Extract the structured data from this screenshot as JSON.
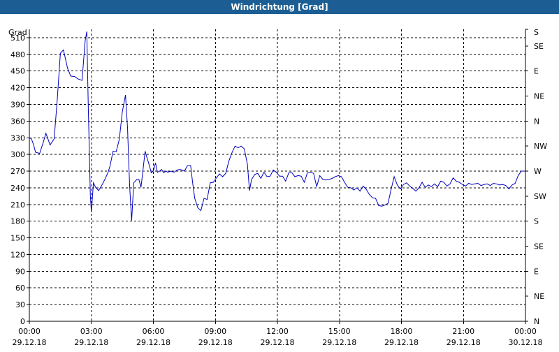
{
  "window": {
    "title": "Windrichtung [Grad]"
  },
  "colors": {
    "titlebar": "#1c5e93",
    "line": "#0000c0",
    "grid": "#000000"
  },
  "chart_data": {
    "type": "line",
    "title": "Windrichtung [Grad]",
    "ylabel": "Grad",
    "ylim": [
      0,
      525
    ],
    "grid": true,
    "y_ticks": [
      0,
      30,
      60,
      90,
      120,
      150,
      180,
      210,
      240,
      270,
      300,
      330,
      360,
      390,
      420,
      450,
      480,
      510
    ],
    "right_axis": {
      "ticks": [
        {
          "value": 0,
          "label": "N"
        },
        {
          "value": 45,
          "label": "NE"
        },
        {
          "value": 90,
          "label": "E"
        },
        {
          "value": 135,
          "label": "SE"
        },
        {
          "value": 180,
          "label": "S"
        },
        {
          "value": 225,
          "label": "SW"
        },
        {
          "value": 270,
          "label": "W"
        },
        {
          "value": 315,
          "label": "NW"
        },
        {
          "value": 360,
          "label": "N"
        },
        {
          "value": 405,
          "label": "NE"
        },
        {
          "value": 450,
          "label": "E"
        },
        {
          "value": 495,
          "label": "SE"
        },
        {
          "value": 540,
          "label": "S"
        }
      ]
    },
    "x_range_hours": [
      0,
      24
    ],
    "x_ticks": [
      {
        "hour": 0,
        "time": "00:00",
        "date": "29.12.18"
      },
      {
        "hour": 3,
        "time": "03:00",
        "date": "29.12.18"
      },
      {
        "hour": 6,
        "time": "06:00",
        "date": "29.12.18"
      },
      {
        "hour": 9,
        "time": "09:00",
        "date": "29.12.18"
      },
      {
        "hour": 12,
        "time": "12:00",
        "date": "29.12.18"
      },
      {
        "hour": 15,
        "time": "15:00",
        "date": "29.12.18"
      },
      {
        "hour": 18,
        "time": "18:00",
        "date": "29.12.18"
      },
      {
        "hour": 21,
        "time": "21:00",
        "date": "29.12.18"
      },
      {
        "hour": 24,
        "time": "00:00",
        "date": "30.12.18"
      }
    ],
    "series": [
      {
        "color": "#0000c0",
        "points": [
          [
            0,
            330
          ],
          [
            0.1,
            328
          ],
          [
            0.2,
            318
          ],
          [
            0.3,
            304
          ],
          [
            0.5,
            302
          ],
          [
            0.7,
            325
          ],
          [
            0.8,
            338
          ],
          [
            0.9,
            328
          ],
          [
            1.0,
            317
          ],
          [
            1.2,
            328
          ],
          [
            1.35,
            398
          ],
          [
            1.5,
            482
          ],
          [
            1.65,
            488
          ],
          [
            1.85,
            455
          ],
          [
            2.0,
            441
          ],
          [
            2.2,
            440
          ],
          [
            2.35,
            436
          ],
          [
            2.55,
            433
          ],
          [
            2.7,
            505
          ],
          [
            2.78,
            521
          ],
          [
            2.85,
            388
          ],
          [
            2.95,
            226
          ],
          [
            3.0,
            196
          ],
          [
            3.1,
            249
          ],
          [
            3.2,
            241
          ],
          [
            3.35,
            235
          ],
          [
            3.5,
            244
          ],
          [
            3.65,
            255
          ],
          [
            3.8,
            267
          ],
          [
            3.9,
            279
          ],
          [
            4.05,
            306
          ],
          [
            4.2,
            305
          ],
          [
            4.35,
            327
          ],
          [
            4.5,
            377
          ],
          [
            4.65,
            407
          ],
          [
            4.75,
            348
          ],
          [
            4.85,
            244
          ],
          [
            4.95,
            181
          ],
          [
            5.05,
            249
          ],
          [
            5.2,
            255
          ],
          [
            5.3,
            255
          ],
          [
            5.4,
            241
          ],
          [
            5.5,
            273
          ],
          [
            5.6,
            306
          ],
          [
            5.7,
            293
          ],
          [
            5.8,
            281
          ],
          [
            5.9,
            267
          ],
          [
            6.0,
            270
          ],
          [
            6.1,
            285
          ],
          [
            6.2,
            268
          ],
          [
            6.3,
            270
          ],
          [
            6.4,
            273
          ],
          [
            6.5,
            267
          ],
          [
            6.6,
            270
          ],
          [
            6.7,
            268
          ],
          [
            6.85,
            270
          ],
          [
            7.0,
            268
          ],
          [
            7.15,
            272
          ],
          [
            7.3,
            273
          ],
          [
            7.5,
            270
          ],
          [
            7.65,
            280
          ],
          [
            7.8,
            280
          ],
          [
            7.9,
            249
          ],
          [
            8.0,
            221
          ],
          [
            8.15,
            204
          ],
          [
            8.3,
            199
          ],
          [
            8.45,
            221
          ],
          [
            8.6,
            219
          ],
          [
            8.75,
            249
          ],
          [
            8.9,
            250
          ],
          [
            9.05,
            258
          ],
          [
            9.2,
            265
          ],
          [
            9.35,
            260
          ],
          [
            9.5,
            266
          ],
          [
            9.65,
            288
          ],
          [
            9.8,
            303
          ],
          [
            9.95,
            315
          ],
          [
            10.1,
            312
          ],
          [
            10.25,
            315
          ],
          [
            10.4,
            310
          ],
          [
            10.55,
            282
          ],
          [
            10.65,
            235
          ],
          [
            10.75,
            255
          ],
          [
            10.9,
            264
          ],
          [
            11.05,
            266
          ],
          [
            11.2,
            257
          ],
          [
            11.35,
            268
          ],
          [
            11.5,
            260
          ],
          [
            11.65,
            261
          ],
          [
            11.8,
            272
          ],
          [
            11.95,
            268
          ],
          [
            12.1,
            261
          ],
          [
            12.25,
            261
          ],
          [
            12.4,
            252
          ],
          [
            12.55,
            267
          ],
          [
            12.7,
            267
          ],
          [
            12.85,
            260
          ],
          [
            13.0,
            262
          ],
          [
            13.15,
            261
          ],
          [
            13.3,
            250
          ],
          [
            13.45,
            267
          ],
          [
            13.6,
            268
          ],
          [
            13.75,
            266
          ],
          [
            13.9,
            242
          ],
          [
            14.05,
            262
          ],
          [
            14.2,
            255
          ],
          [
            14.35,
            254
          ],
          [
            14.5,
            255
          ],
          [
            14.65,
            257
          ],
          [
            14.8,
            260
          ],
          [
            14.95,
            262
          ],
          [
            15.1,
            260
          ],
          [
            15.25,
            250
          ],
          [
            15.4,
            241
          ],
          [
            15.55,
            240
          ],
          [
            15.7,
            236
          ],
          [
            15.85,
            240
          ],
          [
            16.0,
            234
          ],
          [
            16.15,
            243
          ],
          [
            16.3,
            237
          ],
          [
            16.45,
            228
          ],
          [
            16.6,
            222
          ],
          [
            16.75,
            221
          ],
          [
            16.9,
            208
          ],
          [
            17.05,
            207
          ],
          [
            17.2,
            209
          ],
          [
            17.35,
            212
          ],
          [
            17.5,
            237
          ],
          [
            17.65,
            260
          ],
          [
            17.8,
            245
          ],
          [
            17.95,
            238
          ],
          [
            18.1,
            246
          ],
          [
            18.25,
            249
          ],
          [
            18.4,
            243
          ],
          [
            18.55,
            239
          ],
          [
            18.7,
            234
          ],
          [
            18.85,
            240
          ],
          [
            19.0,
            250
          ],
          [
            19.15,
            241
          ],
          [
            19.3,
            245
          ],
          [
            19.45,
            242
          ],
          [
            19.6,
            247
          ],
          [
            19.75,
            242
          ],
          [
            19.9,
            252
          ],
          [
            20.05,
            250
          ],
          [
            20.2,
            243
          ],
          [
            20.35,
            247
          ],
          [
            20.5,
            258
          ],
          [
            20.65,
            252
          ],
          [
            20.8,
            250
          ],
          [
            20.95,
            246
          ],
          [
            21.1,
            243
          ],
          [
            21.25,
            248
          ],
          [
            21.4,
            246
          ],
          [
            21.55,
            247
          ],
          [
            21.7,
            248
          ],
          [
            21.85,
            244
          ],
          [
            22.0,
            246
          ],
          [
            22.15,
            247
          ],
          [
            22.3,
            244
          ],
          [
            22.45,
            248
          ],
          [
            22.6,
            247
          ],
          [
            22.75,
            245
          ],
          [
            22.9,
            246
          ],
          [
            23.05,
            244
          ],
          [
            23.2,
            238
          ],
          [
            23.35,
            245
          ],
          [
            23.5,
            248
          ],
          [
            23.65,
            262
          ],
          [
            23.8,
            270
          ],
          [
            23.95,
            270
          ]
        ]
      }
    ]
  }
}
